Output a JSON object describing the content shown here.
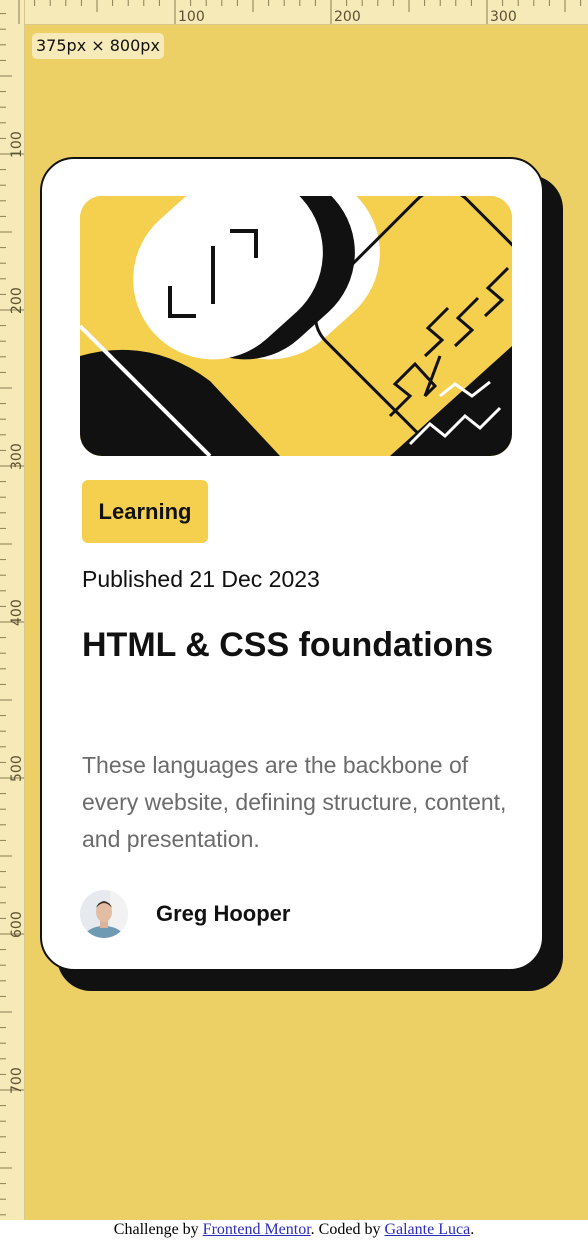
{
  "viewport_badge": "375px × 800px",
  "ruler": {
    "top_labels": [
      "100",
      "200",
      "300"
    ],
    "left_labels": [
      "100",
      "200",
      "300",
      "400",
      "500",
      "600",
      "700"
    ]
  },
  "card": {
    "hero_image": "abstract-geometric-illustration",
    "tag": "Learning",
    "published": "Published 21 Dec 2023",
    "title": "HTML & CSS foundations",
    "description": "These languages are the backbone of every website, defining structure, content, and presentation.",
    "author": "Greg Hooper",
    "avatar": "author-avatar"
  },
  "footer": {
    "prefix": "Challenge by ",
    "link1": "Frontend Mentor",
    "middle": ". Coded by ",
    "link2": "Galante Luca",
    "suffix": "."
  },
  "colors": {
    "background": "#ecd066",
    "accent": "#f4d04e",
    "ink": "#111111",
    "muted": "#6b6b6b"
  }
}
